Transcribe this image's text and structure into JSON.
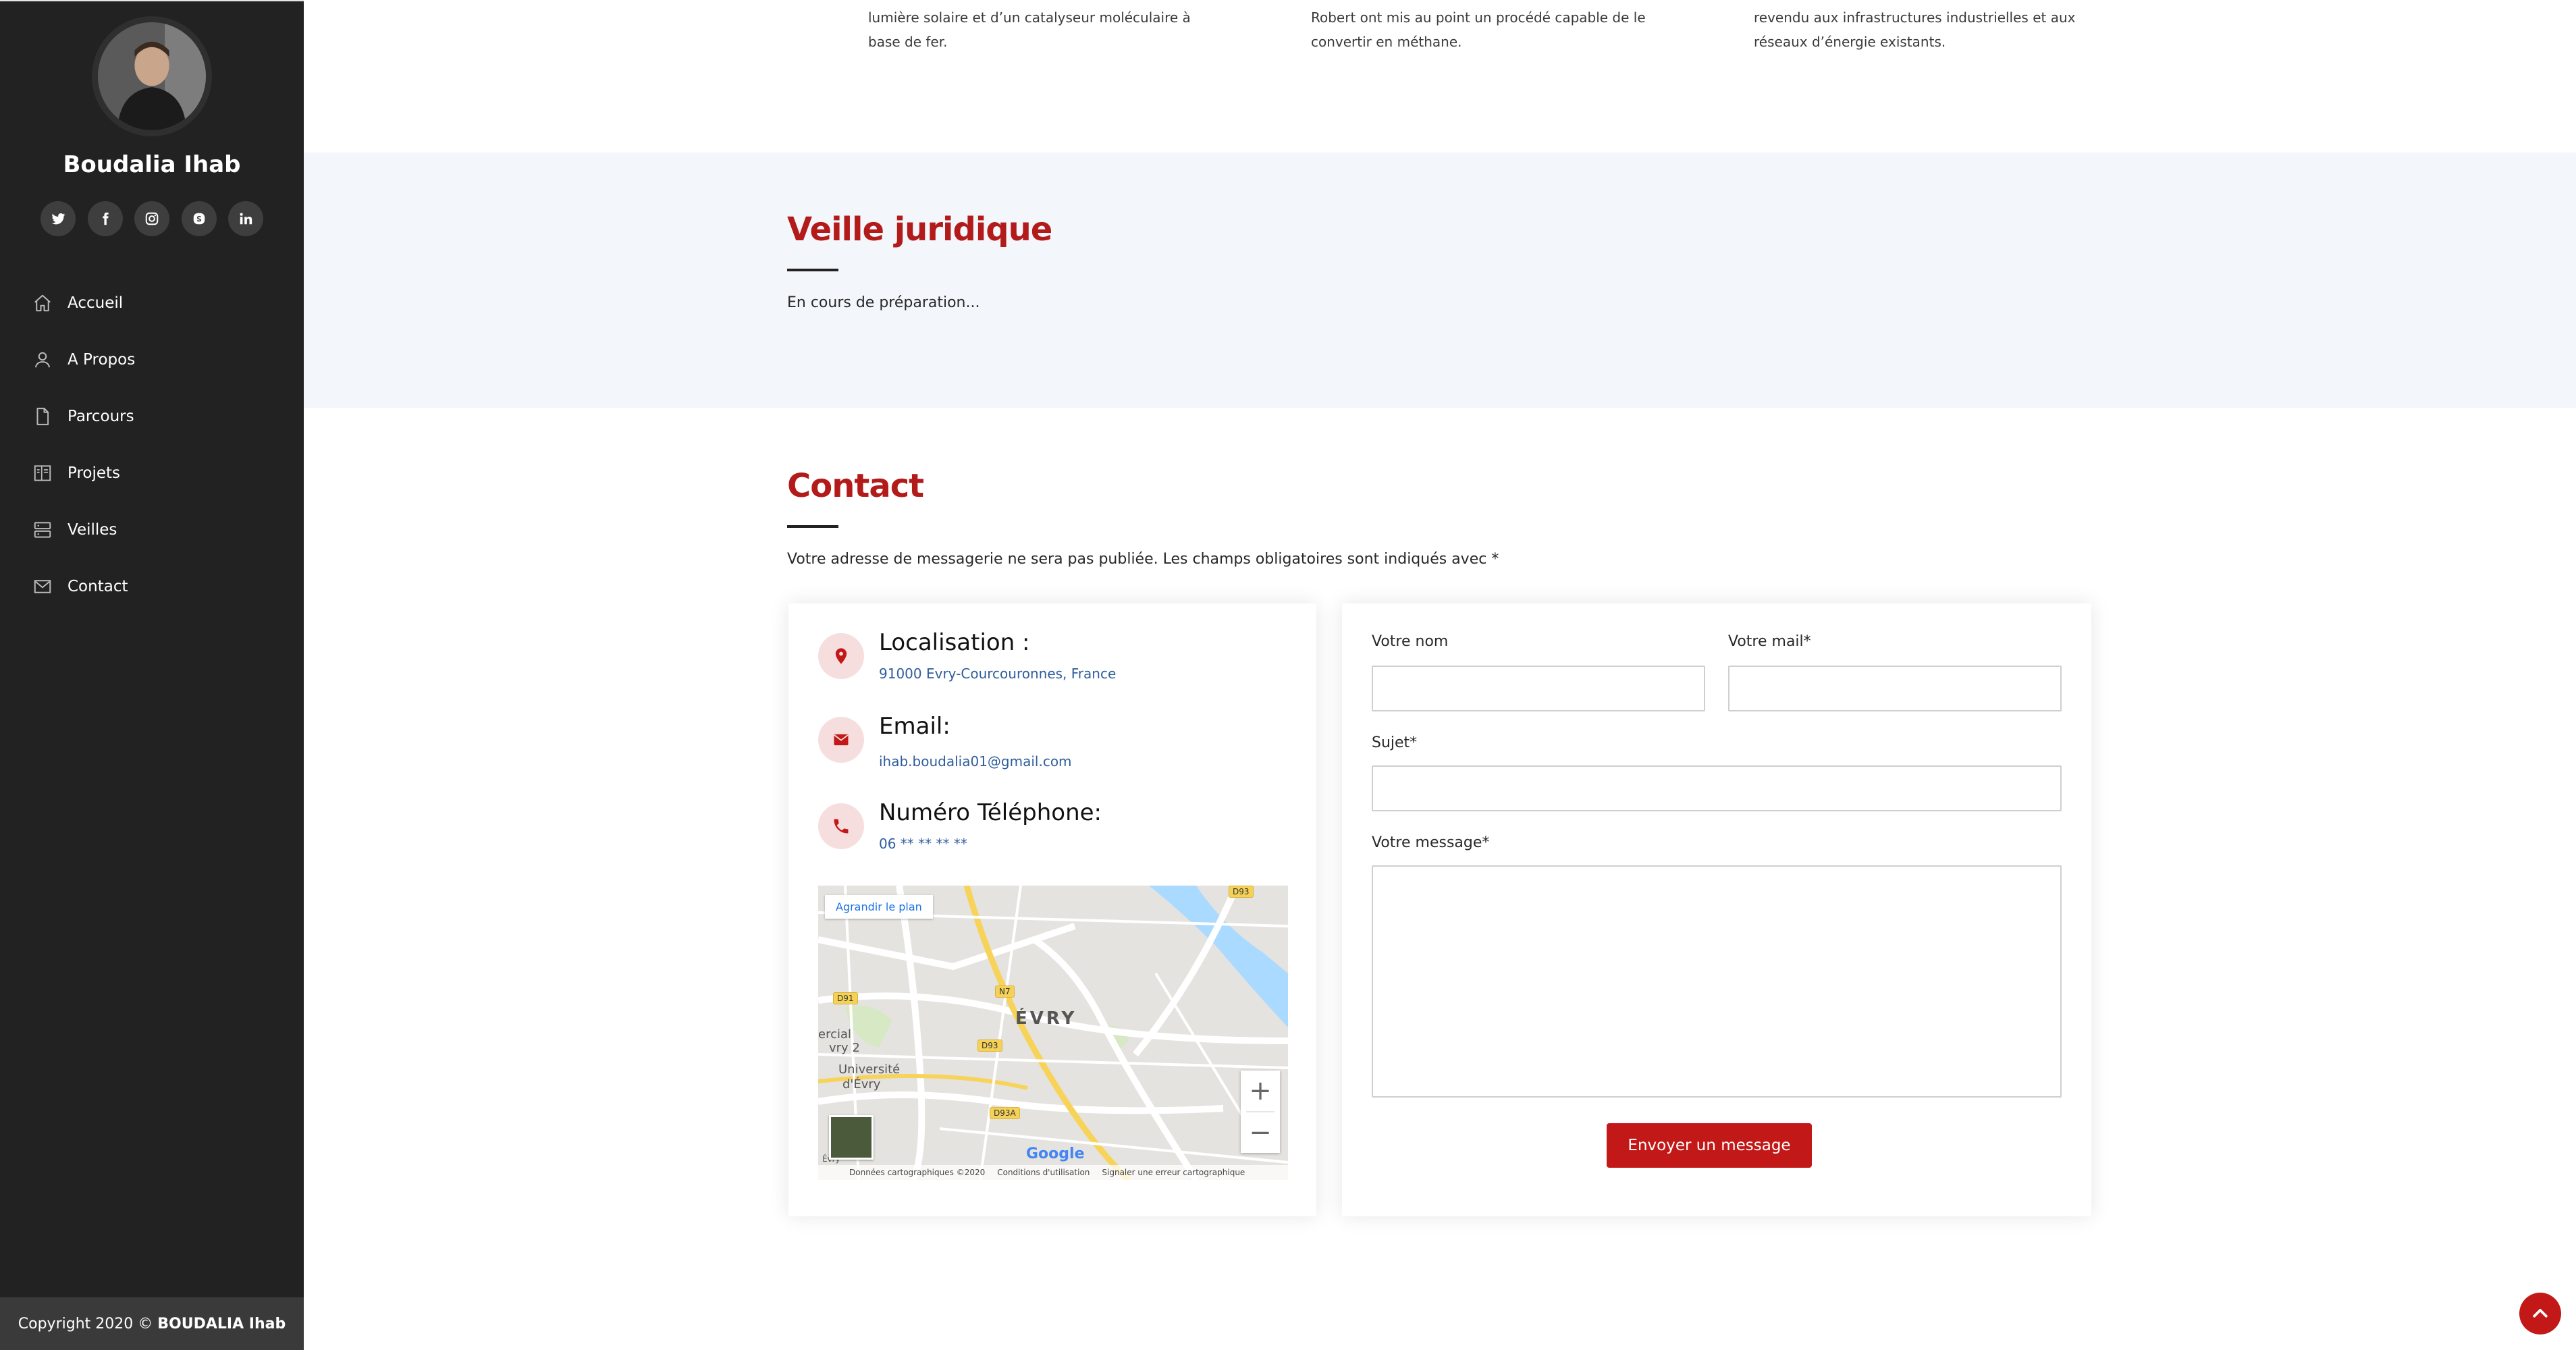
{
  "profile": {
    "name": "Boudalia Ihab"
  },
  "socials": [
    {
      "name": "twitter-icon",
      "glyph": "𝕥"
    },
    {
      "name": "facebook-icon",
      "glyph": "f"
    },
    {
      "name": "instagram-icon",
      "glyph": "◎"
    },
    {
      "name": "skype-icon",
      "glyph": "S"
    },
    {
      "name": "linkedin-icon",
      "glyph": "in"
    }
  ],
  "nav": {
    "items": [
      {
        "label": "Accueil",
        "icon": "home-icon"
      },
      {
        "label": "A Propos",
        "icon": "user-icon"
      },
      {
        "label": "Parcours",
        "icon": "file-icon"
      },
      {
        "label": "Projets",
        "icon": "book-icon"
      },
      {
        "label": "Veilles",
        "icon": "server-icon"
      },
      {
        "label": "Contact",
        "icon": "envelope-icon"
      }
    ]
  },
  "footer": {
    "copyright_prefix": "Copyright 2020 ©",
    "copyright_owner": "BOUDALIA Ihab"
  },
  "top_texts": {
    "col1": "lumière solaire et d’un catalyseur moléculaire à base de fer.",
    "col2": "Robert ont mis au point un procédé capable de le convertir en méthane.",
    "col3": "revendu aux infrastructures industrielles et aux réseaux d’énergie existants."
  },
  "veille": {
    "title": "Veille juridique",
    "text": "En cours de préparation..."
  },
  "contact": {
    "title": "Contact",
    "intro": "Votre adresse de messagerie ne sera pas publiée. Les champs obligatoires sont indiqués avec *",
    "location": {
      "title": "Localisation :",
      "value": "91000 Evry-Courcouronnes, France"
    },
    "email": {
      "title": "Email:",
      "value": "ihab.boudalia01@gmail.com"
    },
    "phone": {
      "title": "Numéro Téléphone:",
      "value": "06 ** ** ** **"
    },
    "map": {
      "link": "Agrandir le plan",
      "city": "ÉVRY",
      "labels": [
        "ercial",
        "vry 2",
        "Université",
        "d'Évry",
        "Évry"
      ],
      "roads": [
        "N7",
        "D91",
        "D93",
        "D93A",
        "D93"
      ],
      "footer": [
        "Données cartographiques ©2020",
        "Conditions d'utilisation",
        "Signaler une erreur cartographique"
      ],
      "logo": "Google",
      "zoom_in": "+",
      "zoom_out": "−"
    },
    "form": {
      "name_label": "Votre nom",
      "mail_label": "Votre mail*",
      "subject_label": "Sujet*",
      "message_label": "Votre message*",
      "name_value": "",
      "mail_value": "",
      "subject_value": "",
      "message_value": "",
      "submit": "Envoyer un message"
    }
  },
  "colors": {
    "accent": "#c21818",
    "title": "#b31b1b",
    "sidebar": "#222222",
    "light_section": "#f3f6fa"
  }
}
